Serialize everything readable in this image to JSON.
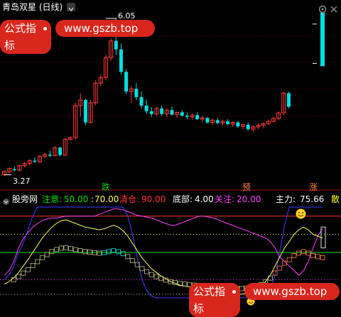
{
  "header": {
    "stock_name": "青岛双星 (日线)",
    "dropdown_icon": "chevron-down-icon",
    "settings_icon": "settings-icon",
    "close_icon": "close-icon"
  },
  "watermark": {
    "label": "公式指标",
    "url": "www.gszb.top",
    "bg_color": "#d9261c"
  },
  "price_panel": {
    "high_label": "6.05",
    "low_label": "3.27",
    "signals": [
      {
        "text": "跌",
        "color": "#00c800"
      },
      {
        "text": "预",
        "color": "#ff8040"
      },
      {
        "text": "涨",
        "color": "#ff8040"
      }
    ]
  },
  "indicator_bar": {
    "name": "股旁网",
    "items": [
      {
        "label": "注意:",
        "value": "50.00",
        "color": "#00e000"
      },
      {
        "label": ":",
        "value": "70.00",
        "color": "#ffff55"
      },
      {
        "label": "清仓:",
        "value": "90.00",
        "color": "#ff3333"
      },
      {
        "label": "底部:",
        "value": "4.00",
        "color": "#ffffff"
      },
      {
        "label": "关注:",
        "value": "20.00",
        "color": "#ff40ff"
      },
      {
        "label": "主力:",
        "value": "75.66",
        "color": "#ffffff"
      },
      {
        "label": "散",
        "value": "",
        "color": "#ffff00"
      }
    ]
  },
  "chart_data": [
    {
      "type": "candlestick",
      "title": "青岛双星 (日线)",
      "annotations": {
        "high": 6.05,
        "low": 3.27
      },
      "ohlc": [
        [
          3.27,
          3.35,
          3.25,
          3.33
        ],
        [
          3.32,
          3.4,
          3.3,
          3.38
        ],
        [
          3.37,
          3.42,
          3.33,
          3.35
        ],
        [
          3.35,
          3.45,
          3.33,
          3.43
        ],
        [
          3.43,
          3.5,
          3.4,
          3.47
        ],
        [
          3.47,
          3.55,
          3.44,
          3.52
        ],
        [
          3.52,
          3.58,
          3.48,
          3.5
        ],
        [
          3.5,
          3.62,
          3.48,
          3.6
        ],
        [
          3.6,
          3.66,
          3.56,
          3.63
        ],
        [
          3.63,
          3.7,
          3.58,
          3.61
        ],
        [
          3.61,
          3.78,
          3.6,
          3.75
        ],
        [
          3.75,
          3.77,
          3.6,
          3.62
        ],
        [
          3.62,
          3.92,
          3.6,
          3.9
        ],
        [
          3.9,
          3.95,
          3.88,
          3.93
        ],
        [
          3.93,
          4.55,
          3.9,
          4.5
        ],
        [
          4.5,
          4.72,
          4.3,
          4.6
        ],
        [
          4.6,
          4.62,
          4.15,
          4.2
        ],
        [
          4.2,
          4.6,
          4.18,
          4.55
        ],
        [
          4.55,
          4.95,
          4.5,
          4.9
        ],
        [
          4.9,
          5.05,
          4.85,
          5.0
        ],
        [
          5.0,
          5.4,
          4.95,
          5.35
        ],
        [
          5.35,
          5.7,
          5.3,
          5.65
        ],
        [
          5.65,
          6.05,
          5.4,
          5.5
        ],
        [
          5.5,
          5.6,
          5.05,
          5.1
        ],
        [
          5.1,
          5.15,
          4.7,
          4.75
        ],
        [
          4.75,
          4.85,
          4.55,
          4.8
        ],
        [
          4.8,
          4.9,
          4.6,
          4.65
        ],
        [
          4.65,
          4.75,
          4.45,
          4.5
        ],
        [
          4.5,
          4.6,
          4.35,
          4.4
        ],
        [
          4.4,
          4.47,
          4.3,
          4.35
        ],
        [
          4.35,
          4.48,
          4.32,
          4.45
        ],
        [
          4.45,
          4.5,
          4.32,
          4.35
        ],
        [
          4.35,
          4.45,
          4.3,
          4.42
        ],
        [
          4.42,
          4.48,
          4.32,
          4.34
        ],
        [
          4.34,
          4.4,
          4.28,
          4.38
        ],
        [
          4.38,
          4.42,
          4.3,
          4.32
        ],
        [
          4.32,
          4.38,
          4.26,
          4.3
        ],
        [
          4.3,
          4.36,
          4.25,
          4.33
        ],
        [
          4.33,
          4.38,
          4.24,
          4.26
        ],
        [
          4.26,
          4.32,
          4.2,
          4.28
        ],
        [
          4.28,
          4.3,
          4.18,
          4.2
        ],
        [
          4.2,
          4.27,
          4.16,
          4.24
        ],
        [
          4.24,
          4.28,
          4.17,
          4.19
        ],
        [
          4.19,
          4.25,
          4.15,
          4.22
        ],
        [
          4.22,
          4.26,
          4.15,
          4.17
        ],
        [
          4.17,
          4.22,
          4.12,
          4.2
        ],
        [
          4.2,
          4.23,
          4.1,
          4.13
        ],
        [
          4.13,
          4.18,
          4.08,
          4.16
        ],
        [
          4.16,
          4.2,
          4.05,
          4.08
        ],
        [
          4.08,
          4.15,
          4.03,
          4.12
        ],
        [
          4.12,
          4.18,
          4.08,
          4.15
        ],
        [
          4.15,
          4.2,
          4.1,
          4.18
        ],
        [
          4.18,
          4.25,
          4.15,
          4.22
        ],
        [
          4.22,
          4.3,
          4.2,
          4.27
        ],
        [
          4.27,
          4.4,
          4.25,
          4.37
        ],
        [
          4.37,
          4.75,
          4.33,
          4.72
        ],
        [
          4.72,
          4.75,
          4.45,
          4.48
        ]
      ],
      "side_bar": {
        "from": 5.2,
        "to": 6.15,
        "ticks": [
          5.95,
          5.25
        ]
      }
    },
    {
      "type": "line",
      "title": "股旁网",
      "levels": [
        {
          "name": "清仓",
          "value": 90,
          "color": "#ff3333"
        },
        {
          "name": "",
          "value": 70,
          "color": "#ffff55"
        },
        {
          "name": "注意",
          "value": 50,
          "color": "#00e000"
        },
        {
          "name": "关注",
          "value": 20,
          "color": "#ff40ff"
        },
        {
          "name": "底部",
          "value": 4,
          "color": "#ffffff"
        }
      ],
      "series": [
        {
          "name": "主力",
          "color": "#ff40ff",
          "values": [
            25,
            30,
            40,
            55,
            65,
            72,
            78,
            82,
            85,
            87,
            88,
            88,
            89,
            90,
            90,
            90,
            90,
            90,
            90,
            90,
            92,
            94,
            96,
            98,
            98,
            97,
            95,
            93,
            91,
            90,
            89,
            88,
            86,
            84,
            82,
            80,
            80,
            82,
            84,
            86,
            88,
            90,
            90,
            89,
            88,
            86,
            84,
            82,
            80,
            78,
            76,
            74,
            72,
            70,
            68,
            66,
            62,
            55,
            45,
            40,
            35,
            30,
            25,
            30,
            40,
            55,
            68,
            76
          ]
        },
        {
          "name": "",
          "color": "#4040ff",
          "values": [
            20,
            25,
            35,
            50,
            60,
            75,
            90,
            100,
            100,
            100,
            100,
            100,
            100,
            100,
            100,
            100,
            100,
            100,
            100,
            100,
            100,
            100,
            100,
            100,
            100,
            100,
            90,
            70,
            45,
            20,
            8,
            2,
            0,
            0,
            0,
            0,
            0,
            0,
            0,
            0,
            0,
            0,
            0,
            0,
            0,
            0,
            0,
            0,
            0,
            0,
            0,
            0,
            0,
            0,
            0,
            2,
            8,
            25,
            50,
            80,
            100,
            100,
            100,
            100,
            100,
            100,
            100,
            100
          ]
        },
        {
          "name": "",
          "color": "#ffff55",
          "values": [
            15,
            18,
            22,
            28,
            35,
            42,
            50,
            58,
            66,
            72,
            78,
            82,
            85,
            86,
            84,
            82,
            80,
            78,
            77,
            76,
            75,
            76,
            78,
            80,
            78,
            74,
            68,
            60,
            52,
            44,
            38,
            32,
            28,
            24,
            21,
            18,
            16,
            14,
            13,
            12,
            11,
            10,
            9,
            8,
            7,
            6,
            5,
            5,
            4,
            4,
            4,
            5,
            6,
            8,
            12,
            18,
            25,
            35,
            45,
            55,
            62,
            70,
            75,
            78,
            75,
            70,
            68,
            66
          ]
        }
      ],
      "ylim": [
        0,
        100
      ]
    }
  ]
}
